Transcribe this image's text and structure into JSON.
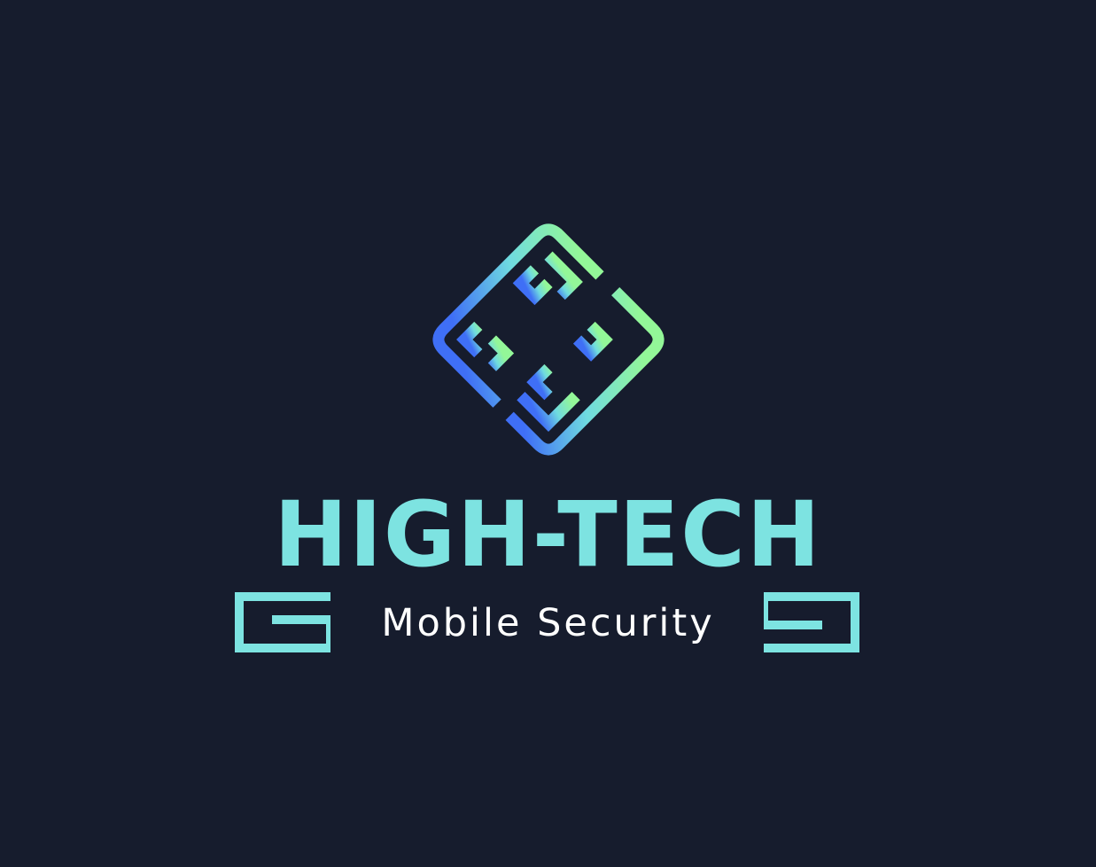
{
  "logo": {
    "name": "HIGH-TECH",
    "tagline": "Mobile Security"
  },
  "colors": {
    "background": "#161c2d",
    "text_primary": "#7de3e1",
    "text_secondary": "#ffffff",
    "gradient_top": "#8ff59a",
    "gradient_bottom": "#3f73f5"
  },
  "icons": {
    "mark": "maze-diamond-icon",
    "left_ornament": "left-bracket-ornament",
    "right_ornament": "right-bracket-ornament"
  }
}
